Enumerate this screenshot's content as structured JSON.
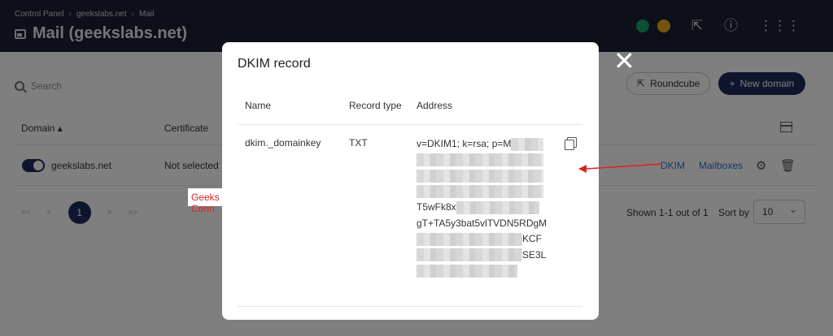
{
  "breadcrumb": [
    "Control Panel",
    "geekslabs.net",
    "Mail"
  ],
  "page_title": "Mail (geekslabs.net)",
  "search": {
    "placeholder": "Search"
  },
  "toolbar": {
    "roundcube_label": "Roundcube",
    "new_domain_label": "New domain"
  },
  "table": {
    "headers": {
      "domain": "Domain",
      "certificate": "Certificate"
    },
    "rows": [
      {
        "domain": "geekslabs.net",
        "certificate": "Not selected",
        "dkim_link": "DKIM",
        "mailboxes_link": "Mailboxes"
      }
    ]
  },
  "pagination": {
    "current_page": "1",
    "first": "<<",
    "prev": "<",
    "next": ">",
    "last": ">>"
  },
  "shown_text": "Shown 1-1 out of 1",
  "sort": {
    "label": "Sort by",
    "value": "10"
  },
  "annotation": {
    "text": "Geeks Conn",
    "color": "#dd2222"
  },
  "modal": {
    "title": "DKIM record",
    "headers": {
      "name": "Name",
      "type": "Record type",
      "address": "Address"
    },
    "record": {
      "name": "dkim._domainkey",
      "type": "TXT",
      "address_visible": [
        "v=DKIM1; k=rsa; p=M",
        "T5wFk8x",
        "gT+TA5y3bat5vlTVDN5RDgM",
        "KCF",
        "SE3L"
      ]
    }
  },
  "colors": {
    "header_bg": "#1b2133",
    "primary": "#1c2a5b",
    "link": "#2a6fd6"
  },
  "icons": [
    "external-link-icon",
    "info-icon",
    "apps-grid-icon",
    "copy-icon",
    "close-icon",
    "search-icon",
    "gear-icon",
    "trash-icon",
    "columns-icon"
  ]
}
